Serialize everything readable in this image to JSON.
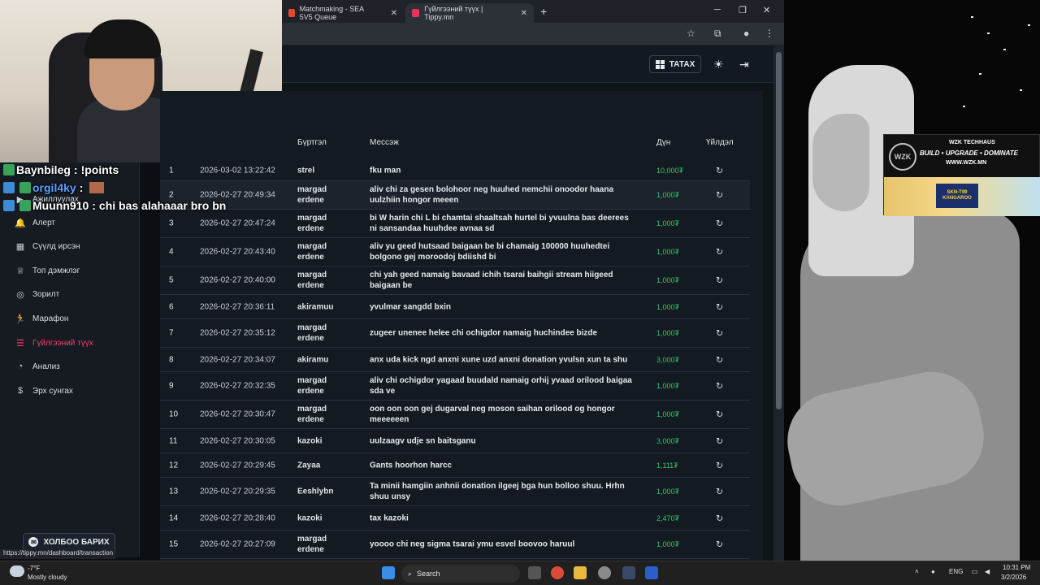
{
  "browser": {
    "tabs": [
      {
        "label": "Matchmaking - SEA 5V5 Queue",
        "close": "✕"
      },
      {
        "label": "Гүйлгээний түүх | Tippy.mn",
        "close": "✕"
      }
    ],
    "new_tab": "+",
    "status_url": "https://tippy.mn/dashboard/transaction"
  },
  "header": {
    "download_label": "ТАТАХ"
  },
  "chat": [
    {
      "name": "Baynbileg",
      "message": "!points"
    },
    {
      "name": "orgil4ky",
      "message": ""
    },
    {
      "name": "Muunn910",
      "message": "chi bas alahaaar bro bn"
    }
  ],
  "sidebar": {
    "items": [
      {
        "label": "Ажиллуулах",
        "icon": "play-icon"
      },
      {
        "label": "Алерт",
        "icon": "bell-icon"
      },
      {
        "label": "Сүүлд ирсэн",
        "icon": "calendar-icon"
      },
      {
        "label": "Топ дэмжлэг",
        "icon": "trophy-icon"
      },
      {
        "label": "Зорилт",
        "icon": "target-icon"
      },
      {
        "label": "Марафон",
        "icon": "runner-icon"
      },
      {
        "label": "Гүйлгээний түүх",
        "icon": "list-icon"
      },
      {
        "label": "Анализ",
        "icon": "chart-icon"
      },
      {
        "label": "Эрх сунгах",
        "icon": "dollar-icon"
      }
    ],
    "contact_label": "ХОЛБОО БАРИХ"
  },
  "table": {
    "columns": {
      "user": "Бүртгэл",
      "message": "Мессэж",
      "amount": "Дүн",
      "action": "Үйлдэл"
    },
    "rows": [
      {
        "num": "1",
        "date": "2026-03-02 13:22:42",
        "user": "strel",
        "message": "fku man",
        "amount": "10,000₮"
      },
      {
        "num": "2",
        "date": "2026-02-27 20:49:34",
        "user": "margad erdene",
        "message": "aliv chi za gesen bolohoor neg huuhed nemchii onoodor haana uulzhiin hongor meeen",
        "amount": "1,000₮"
      },
      {
        "num": "3",
        "date": "2026-02-27 20:47:24",
        "user": "margad erdene",
        "message": "bi W harin chi L bi chamtai shaaltsah hurtel bi yvuulna bas deerees ni sansandaa huuhdee avnaa sd",
        "amount": "1,000₮"
      },
      {
        "num": "4",
        "date": "2026-02-27 20:43:40",
        "user": "margad erdene",
        "message": "aliv yu geed hutsaad baigaan be bi chamaig 100000 huuhedtei bolgono gej moroodoj bdiishd bi",
        "amount": "1,000₮"
      },
      {
        "num": "5",
        "date": "2026-02-27 20:40:00",
        "user": "margad erdene",
        "message": "chi yah geed namaig bavaad ichih tsarai baihgii stream hiigeed baigaan be",
        "amount": "1,000₮"
      },
      {
        "num": "6",
        "date": "2026-02-27 20:36:11",
        "user": "akiramuu",
        "message": "yvulmar sangdd bxin",
        "amount": "1,000₮"
      },
      {
        "num": "7",
        "date": "2026-02-27 20:35:12",
        "user": "margad erdene",
        "message": "zugeer unenee helee chi ochigdor namaig huchindee bizde",
        "amount": "1,000₮"
      },
      {
        "num": "8",
        "date": "2026-02-27 20:34:07",
        "user": "akiramu",
        "message": "anx uda kick ngd anxni xune uzd anxni donation yvulsn xun ta shu",
        "amount": "3,000₮"
      },
      {
        "num": "9",
        "date": "2026-02-27 20:32:35",
        "user": "margad erdene",
        "message": "aliv chi ochigdor yagaad buudald namaig orhij yvaad orilood baigaa sda ve",
        "amount": "1,000₮"
      },
      {
        "num": "10",
        "date": "2026-02-27 20:30:47",
        "user": "margad erdene",
        "message": "oon oon oon gej dugarval neg moson saihan orilood og hongor meeeeeen",
        "amount": "1,000₮"
      },
      {
        "num": "11",
        "date": "2026-02-27 20:30:05",
        "user": "kazoki",
        "message": "uulzaagv udje sn baitsganu",
        "amount": "3,000₮"
      },
      {
        "num": "12",
        "date": "2026-02-27 20:29:45",
        "user": "Zayaa",
        "message": "Gants hoorhon harcc",
        "amount": "1,111₮"
      },
      {
        "num": "13",
        "date": "2026-02-27 20:29:35",
        "user": "Eeshlybn",
        "message": "Ta minii hamgiin anhnii donation ilgeej bga hun bolloo shuu. Hrhn shuu unsy",
        "amount": "1,000₮"
      },
      {
        "num": "14",
        "date": "2026-02-27 20:28:40",
        "user": "kazoki",
        "message": "tax kazoki",
        "amount": "2,470₮"
      },
      {
        "num": "15",
        "date": "2026-02-27 20:27:09",
        "user": "margad erdene",
        "message": "yoooo chi neg sigma tsarai ymu esvel boovoo haruul",
        "amount": "1,000₮"
      }
    ]
  },
  "promo": {
    "logo": "WZK",
    "brand": "WZK TECHHAUS",
    "tagline": "BUILD • UPGRADE • DOMINATE",
    "url": "WWW.WZK.MN",
    "ad_text": "SKN-T99 KANGAROO"
  },
  "taskbar": {
    "weather_temp": "-7°F",
    "weather_desc": "Mostly cloudy",
    "search_label": "Search",
    "lang": "ENG",
    "time": "10:31 PM",
    "date": "3/2/2026"
  },
  "colors": {
    "accent_active": "#ff3b6b",
    "amount_green": "#34c46a",
    "panel_bg": "#141a22"
  }
}
